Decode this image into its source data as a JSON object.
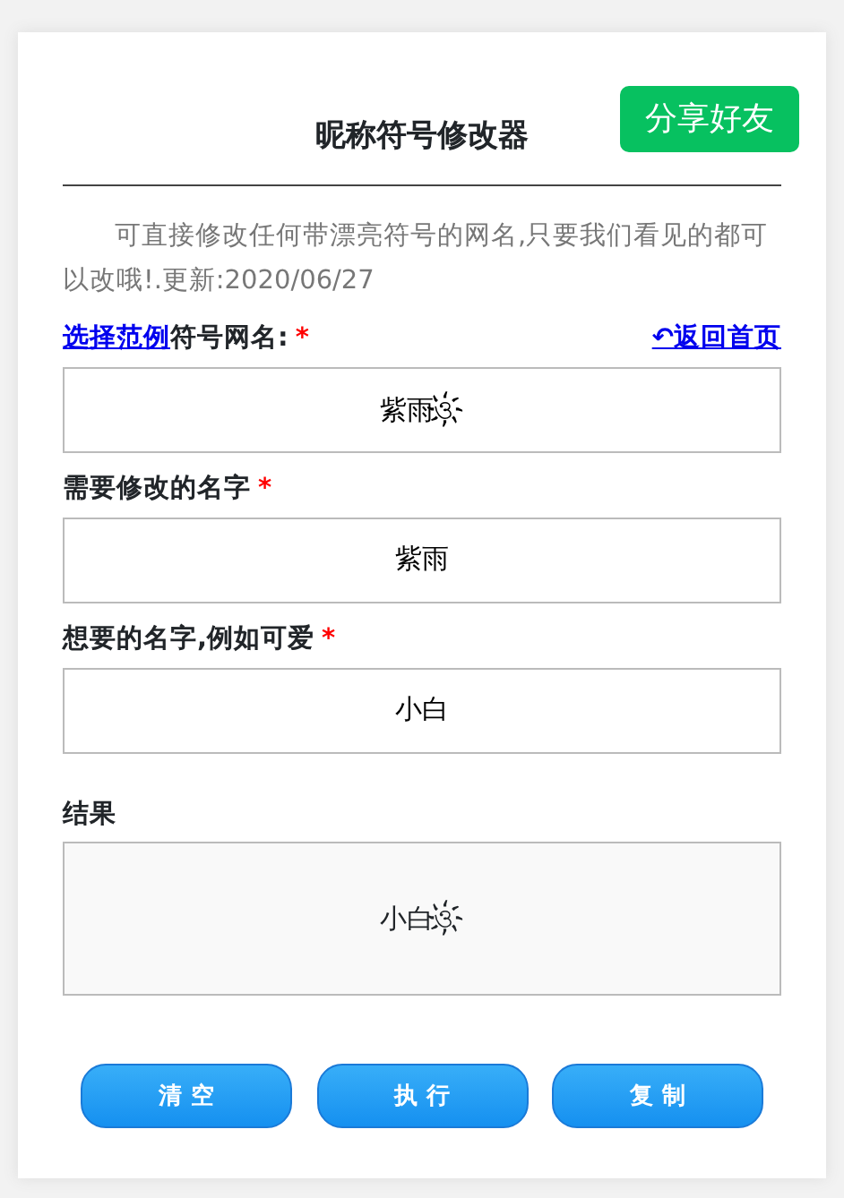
{
  "header": {
    "title": "昵称符号修改器",
    "share_button": "分享好友"
  },
  "intro": "可直接修改任何带漂亮符号的网名,只要我们看见的都可以改哦!.更新:2020/06/27",
  "fields": [
    {
      "label_link": "选择范例",
      "label": "符号网名:",
      "required": "*",
      "aside_link_icon": "↶",
      "aside_link": "返回首页",
      "value": "紫雨ও҉"
    },
    {
      "label": "需要修改的名字",
      "required": "*",
      "value": "紫雨"
    },
    {
      "label": "想要的名字,例如可爱",
      "required": "*",
      "value": "小白"
    }
  ],
  "result": {
    "label": "结果",
    "value": "小白ও҉"
  },
  "buttons": [
    "清 空",
    "执 行",
    "复 制"
  ]
}
